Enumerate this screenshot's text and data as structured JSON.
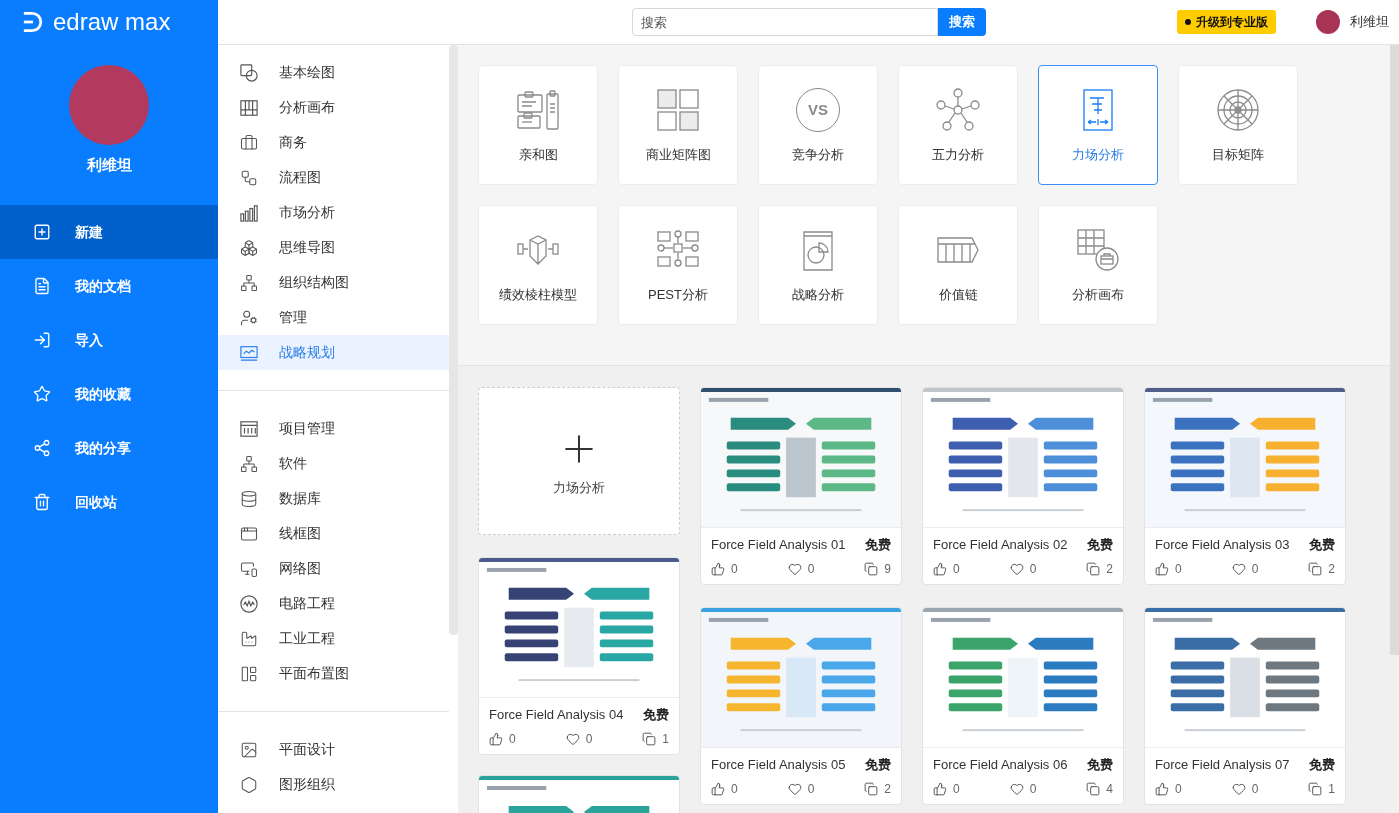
{
  "logo": {
    "text": "edraw max"
  },
  "profile": {
    "name": "利维坦"
  },
  "nav": [
    {
      "label": "新建",
      "selected": true
    },
    {
      "label": "我的文档",
      "selected": false
    },
    {
      "label": "导入",
      "selected": false
    },
    {
      "label": "我的收藏",
      "selected": false
    },
    {
      "label": "我的分享",
      "selected": false
    },
    {
      "label": "回收站",
      "selected": false
    }
  ],
  "header": {
    "search": {
      "placeholder": "搜索",
      "button": "搜索"
    },
    "upgrade_button": "升级到专业版",
    "user_name": "利维坦"
  },
  "categories": [
    {
      "items": [
        {
          "label": "基本绘图",
          "selected": false
        },
        {
          "label": "分析画布",
          "selected": false
        },
        {
          "label": "商务",
          "selected": false
        },
        {
          "label": "流程图",
          "selected": false
        },
        {
          "label": "市场分析",
          "selected": false
        },
        {
          "label": "思维导图",
          "selected": false
        },
        {
          "label": "组织结构图",
          "selected": false
        },
        {
          "label": "管理",
          "selected": false
        },
        {
          "label": "战略规划",
          "selected": true
        }
      ]
    },
    {
      "items": [
        {
          "label": "项目管理",
          "selected": false
        },
        {
          "label": "软件",
          "selected": false
        },
        {
          "label": "数据库",
          "selected": false
        },
        {
          "label": "线框图",
          "selected": false
        },
        {
          "label": "网络图",
          "selected": false
        },
        {
          "label": "电路工程",
          "selected": false
        },
        {
          "label": "工业工程",
          "selected": false
        },
        {
          "label": "平面布置图",
          "selected": false
        }
      ]
    },
    {
      "items": [
        {
          "label": "平面设计",
          "selected": false
        },
        {
          "label": "图形组织",
          "selected": false
        }
      ]
    }
  ],
  "diagram_types": [
    {
      "label": "亲和图",
      "selected": false
    },
    {
      "label": "商业矩阵图",
      "selected": false
    },
    {
      "label": "竞争分析",
      "selected": false,
      "icon_text": "VS"
    },
    {
      "label": "五力分析",
      "selected": false
    },
    {
      "label": "力场分析",
      "selected": true
    },
    {
      "label": "目标矩阵",
      "selected": false
    },
    {
      "label": "绩效棱柱模型",
      "selected": false
    },
    {
      "label": "PEST分析",
      "selected": false
    },
    {
      "label": "战略分析",
      "selected": false
    },
    {
      "label": "价值链",
      "selected": false
    },
    {
      "label": "分析画布",
      "selected": false
    }
  ],
  "new_diagram": {
    "label": "力场分析"
  },
  "templates": [
    {
      "title": "Force Field Analysis 01",
      "price": "免费",
      "likes": "0",
      "favorites": "0",
      "copies": "9"
    },
    {
      "title": "Force Field Analysis 02",
      "price": "免费",
      "likes": "0",
      "favorites": "0",
      "copies": "2"
    },
    {
      "title": "Force Field Analysis 03",
      "price": "免费",
      "likes": "0",
      "favorites": "0",
      "copies": "2"
    },
    {
      "title": "Force Field Analysis 04",
      "price": "免费",
      "likes": "0",
      "favorites": "0",
      "copies": "1"
    },
    {
      "title": "Force Field Analysis 05",
      "price": "免费",
      "likes": "0",
      "favorites": "0",
      "copies": "2"
    },
    {
      "title": "Force Field Analysis 06",
      "price": "免费",
      "likes": "0",
      "favorites": "0",
      "copies": "4"
    },
    {
      "title": "Force Field Analysis 07",
      "price": "免费",
      "likes": "0",
      "favorites": "0",
      "copies": "1"
    }
  ]
}
